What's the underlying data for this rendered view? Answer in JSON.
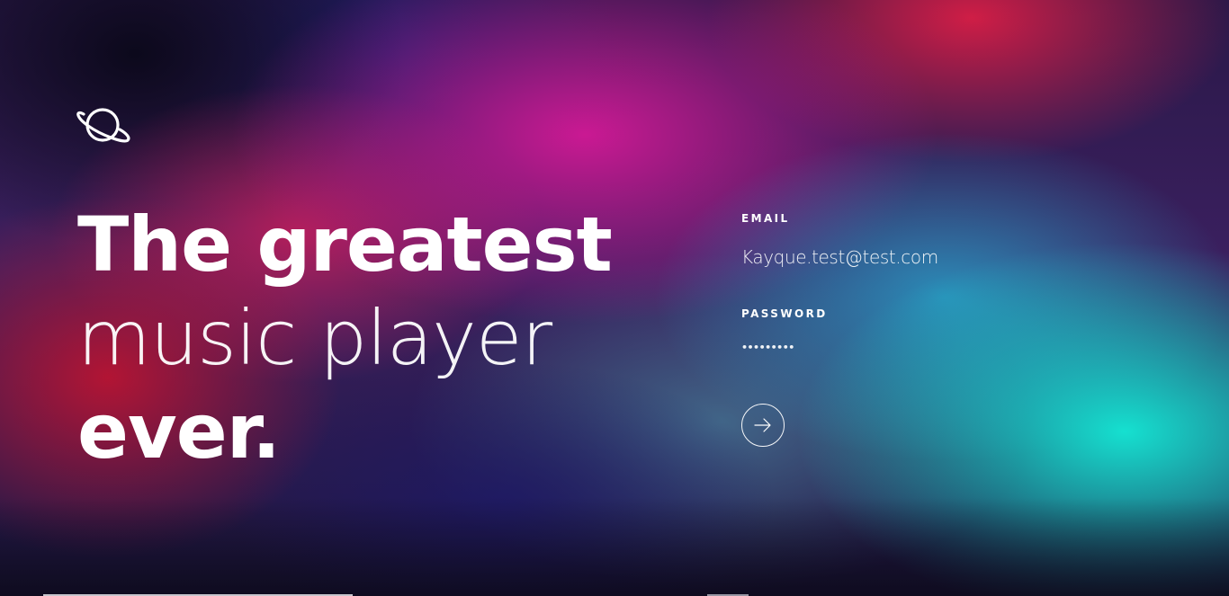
{
  "brand": {
    "logo_icon": "planet-icon",
    "accent_colors": [
      "#c81e8c",
      "#1ee6d8",
      "#b4142d",
      "#1a1440"
    ]
  },
  "hero": {
    "line1": "The greatest",
    "line2": "music player",
    "line3": "ever."
  },
  "login": {
    "email_label": "EMAIL",
    "email_value": "Kayque.test@test.com",
    "password_label": "PASSWORD",
    "password_value": "•••••••••",
    "submit_icon": "arrow-right-icon"
  }
}
